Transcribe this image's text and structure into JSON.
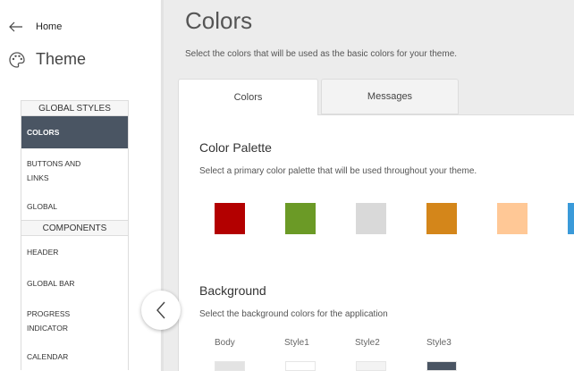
{
  "sidebar": {
    "home_label": "Home",
    "theme_label": "Theme",
    "nav": [
      {
        "type": "section",
        "label": "GLOBAL STYLES"
      },
      {
        "type": "item",
        "label": "COLORS",
        "active": true
      },
      {
        "type": "item",
        "label": "BUTTONS AND LINKS"
      },
      {
        "type": "item",
        "label": "GLOBAL"
      },
      {
        "type": "section",
        "label": "COMPONENTS"
      },
      {
        "type": "item",
        "label": "HEADER"
      },
      {
        "type": "item",
        "label": "GLOBAL BAR"
      },
      {
        "type": "item",
        "label": "PROGRESS INDICATOR"
      },
      {
        "type": "item",
        "label": "CALENDAR"
      }
    ]
  },
  "main": {
    "title": "Colors",
    "subtitle": "Select the colors that will be used as the basic colors for your theme.",
    "tabs": [
      {
        "label": "Colors",
        "active": true
      },
      {
        "label": "Messages",
        "active": false
      }
    ],
    "palette": {
      "title": "Color Palette",
      "description": "Select a primary color palette that will be used throughout your theme.",
      "colors": [
        "#b30000",
        "#6b9a26",
        "#d9d9d9",
        "#d4861a",
        "#ffc896",
        "#3a9ad9"
      ]
    },
    "background": {
      "title": "Background",
      "description": "Select the background colors for the application",
      "options": [
        {
          "label": "Body",
          "color": "#e3e3e3"
        },
        {
          "label": "Style1",
          "color": "#ffffff"
        },
        {
          "label": "Style2",
          "color": "#f3f3f3"
        },
        {
          "label": "Style3",
          "color": "#4a5563"
        }
      ]
    }
  }
}
